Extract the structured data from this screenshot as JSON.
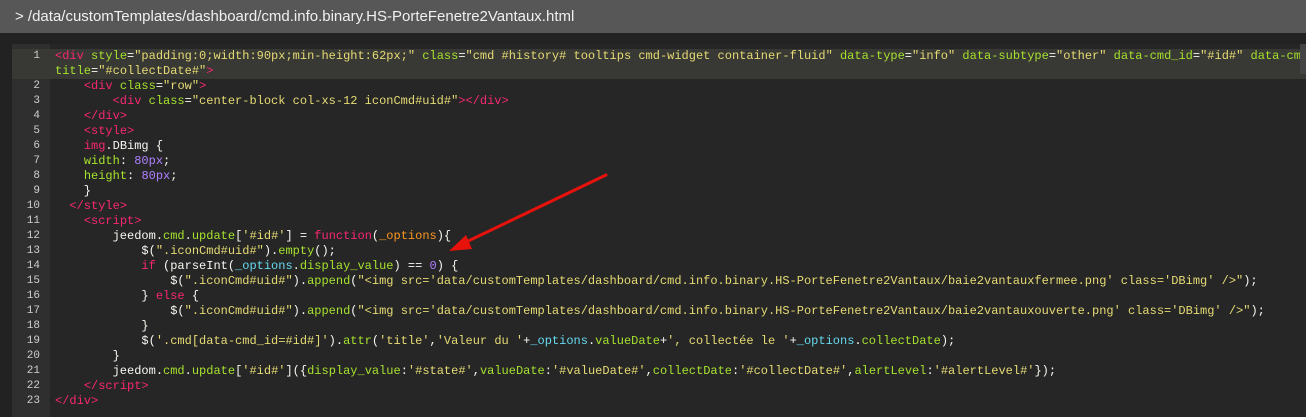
{
  "header": {
    "path": "> /data/customTemplates/dashboard/cmd.info.binary.HS-PorteFenetre2Vantaux.html"
  },
  "colors": {
    "tag": "#f92672",
    "attr": "#a6e22e",
    "string": "#e6db74",
    "number": "#ae81ff",
    "param": "#fd971f",
    "annotation_arrow": "#e8120c"
  },
  "code": {
    "lines": [
      {
        "n": "1",
        "active": true,
        "rows": [
          [
            [
              "t",
              "<div"
            ],
            [
              "p",
              " "
            ],
            [
              "a",
              "style"
            ],
            [
              "p",
              "="
            ],
            [
              "s",
              "\"padding:0;width:90px;min-height:62px;\""
            ],
            [
              "p",
              " "
            ],
            [
              "a",
              "class"
            ],
            [
              "p",
              "="
            ],
            [
              "s",
              "\"cmd #history# tooltips cmd-widget container-fluid\""
            ],
            [
              "p",
              " "
            ],
            [
              "a",
              "data-type"
            ],
            [
              "p",
              "="
            ],
            [
              "s",
              "\"info\""
            ],
            [
              "p",
              " "
            ],
            [
              "a",
              "data-subtype"
            ],
            [
              "p",
              "="
            ],
            [
              "s",
              "\"other\""
            ],
            [
              "p",
              " "
            ],
            [
              "a",
              "data-cmd_id"
            ],
            [
              "p",
              "="
            ],
            [
              "s",
              "\"#id#\""
            ],
            [
              "p",
              " "
            ],
            [
              "a",
              "data-cmd"
            ]
          ],
          [
            [
              "a",
              "title"
            ],
            [
              "p",
              "="
            ],
            [
              "s",
              "\"#collectDate#\""
            ],
            [
              "t",
              ">"
            ]
          ]
        ]
      },
      {
        "n": "2",
        "rows": [
          [
            [
              "p",
              "    "
            ],
            [
              "t",
              "<div"
            ],
            [
              "p",
              " "
            ],
            [
              "a",
              "class"
            ],
            [
              "p",
              "="
            ],
            [
              "s",
              "\"row\""
            ],
            [
              "t",
              ">"
            ]
          ]
        ]
      },
      {
        "n": "3",
        "rows": [
          [
            [
              "p",
              "        "
            ],
            [
              "t",
              "<div"
            ],
            [
              "p",
              " "
            ],
            [
              "a",
              "class"
            ],
            [
              "p",
              "="
            ],
            [
              "s",
              "\"center-block col-xs-12 iconCmd#uid#\""
            ],
            [
              "t",
              "></div>"
            ]
          ]
        ]
      },
      {
        "n": "4",
        "rows": [
          [
            [
              "p",
              "    "
            ],
            [
              "t",
              "</div>"
            ]
          ]
        ]
      },
      {
        "n": "5",
        "rows": [
          [
            [
              "p",
              "    "
            ],
            [
              "t",
              "<style>"
            ]
          ]
        ]
      },
      {
        "n": "6",
        "rows": [
          [
            [
              "p",
              "    "
            ],
            [
              "t",
              "img"
            ],
            [
              "p",
              ".DBimg {"
            ]
          ]
        ]
      },
      {
        "n": "7",
        "rows": [
          [
            [
              "p",
              "    "
            ],
            [
              "a",
              "width"
            ],
            [
              "p",
              ": "
            ],
            [
              "n",
              "80px"
            ],
            [
              "p",
              ";"
            ]
          ]
        ]
      },
      {
        "n": "8",
        "rows": [
          [
            [
              "p",
              "    "
            ],
            [
              "a",
              "height"
            ],
            [
              "p",
              ": "
            ],
            [
              "n",
              "80px"
            ],
            [
              "p",
              ";"
            ]
          ]
        ]
      },
      {
        "n": "9",
        "rows": [
          [
            [
              "p",
              "    }"
            ]
          ]
        ]
      },
      {
        "n": "10",
        "rows": [
          [
            [
              "p",
              "  "
            ],
            [
              "t",
              "</style>"
            ]
          ]
        ]
      },
      {
        "n": "11",
        "rows": [
          [
            [
              "p",
              "    "
            ],
            [
              "t",
              "<script>"
            ]
          ]
        ]
      },
      {
        "n": "12",
        "rows": [
          [
            [
              "p",
              "        jeedom."
            ],
            [
              "f",
              "cmd"
            ],
            [
              "p",
              "."
            ],
            [
              "f",
              "update"
            ],
            [
              "p",
              "["
            ],
            [
              "s",
              "'#id#'"
            ],
            [
              "p",
              "] = "
            ],
            [
              "k",
              "function"
            ],
            [
              "p",
              "("
            ],
            [
              "o",
              "_options"
            ],
            [
              "p",
              "){"
            ]
          ]
        ]
      },
      {
        "n": "13",
        "rows": [
          [
            [
              "p",
              "            $("
            ],
            [
              "s",
              "\".iconCmd#uid#\""
            ],
            [
              "p",
              ")."
            ],
            [
              "f",
              "empty"
            ],
            [
              "p",
              "();"
            ]
          ]
        ]
      },
      {
        "n": "14",
        "rows": [
          [
            [
              "p",
              "            "
            ],
            [
              "k",
              "if"
            ],
            [
              "p",
              " (parseInt("
            ],
            [
              "c",
              "_options"
            ],
            [
              "p",
              "."
            ],
            [
              "f",
              "display_value"
            ],
            [
              "p",
              ") == "
            ],
            [
              "n",
              "0"
            ],
            [
              "p",
              ") {"
            ]
          ]
        ]
      },
      {
        "n": "15",
        "rows": [
          [
            [
              "p",
              "                $("
            ],
            [
              "s",
              "\".iconCmd#uid#\""
            ],
            [
              "p",
              ")."
            ],
            [
              "f",
              "append"
            ],
            [
              "p",
              "("
            ],
            [
              "s",
              "\"<img src='data/customTemplates/dashboard/cmd.info.binary.HS-PorteFenetre2Vantaux/baie2vantauxfermee.png' class='DBimg' />\""
            ],
            [
              "p",
              ");"
            ]
          ]
        ]
      },
      {
        "n": "16",
        "rows": [
          [
            [
              "p",
              "            } "
            ],
            [
              "k",
              "else"
            ],
            [
              "p",
              " {"
            ]
          ]
        ]
      },
      {
        "n": "17",
        "rows": [
          [
            [
              "p",
              "                $("
            ],
            [
              "s",
              "\".iconCmd#uid#\""
            ],
            [
              "p",
              ")."
            ],
            [
              "f",
              "append"
            ],
            [
              "p",
              "("
            ],
            [
              "s",
              "\"<img src='data/customTemplates/dashboard/cmd.info.binary.HS-PorteFenetre2Vantaux/baie2vantauxouverte.png' class='DBimg' />\""
            ],
            [
              "p",
              ");"
            ]
          ]
        ]
      },
      {
        "n": "18",
        "rows": [
          [
            [
              "p",
              "            }"
            ]
          ]
        ]
      },
      {
        "n": "19",
        "rows": [
          [
            [
              "p",
              "            $("
            ],
            [
              "s",
              "'.cmd[data-cmd_id=#id#]'"
            ],
            [
              "p",
              ")."
            ],
            [
              "f",
              "attr"
            ],
            [
              "p",
              "("
            ],
            [
              "s",
              "'title'"
            ],
            [
              "p",
              ","
            ],
            [
              "s",
              "'Valeur du '"
            ],
            [
              "p",
              "+"
            ],
            [
              "c",
              "_options"
            ],
            [
              "p",
              "."
            ],
            [
              "f",
              "valueDate"
            ],
            [
              "p",
              "+"
            ],
            [
              "s",
              "', collectée le '"
            ],
            [
              "p",
              "+"
            ],
            [
              "c",
              "_options"
            ],
            [
              "p",
              "."
            ],
            [
              "f",
              "collectDate"
            ],
            [
              "p",
              ");"
            ]
          ]
        ]
      },
      {
        "n": "20",
        "rows": [
          [
            [
              "p",
              "        }"
            ]
          ]
        ]
      },
      {
        "n": "21",
        "rows": [
          [
            [
              "p",
              "        jeedom."
            ],
            [
              "f",
              "cmd"
            ],
            [
              "p",
              "."
            ],
            [
              "f",
              "update"
            ],
            [
              "p",
              "["
            ],
            [
              "s",
              "'#id#'"
            ],
            [
              "p",
              "]({"
            ],
            [
              "f",
              "display_value"
            ],
            [
              "p",
              ":"
            ],
            [
              "s",
              "'#state#'"
            ],
            [
              "p",
              ","
            ],
            [
              "f",
              "valueDate"
            ],
            [
              "p",
              ":"
            ],
            [
              "s",
              "'#valueDate#'"
            ],
            [
              "p",
              ","
            ],
            [
              "f",
              "collectDate"
            ],
            [
              "p",
              ":"
            ],
            [
              "s",
              "'#collectDate#'"
            ],
            [
              "p",
              ","
            ],
            [
              "f",
              "alertLevel"
            ],
            [
              "p",
              ":"
            ],
            [
              "s",
              "'#alertLevel#'"
            ],
            [
              "p",
              "});"
            ]
          ]
        ]
      },
      {
        "n": "22",
        "rows": [
          [
            [
              "p",
              "    "
            ],
            [
              "t",
              "</script>"
            ]
          ]
        ]
      },
      {
        "n": "23",
        "rows": [
          [
            [
              "t",
              "</div>"
            ]
          ]
        ]
      }
    ]
  }
}
